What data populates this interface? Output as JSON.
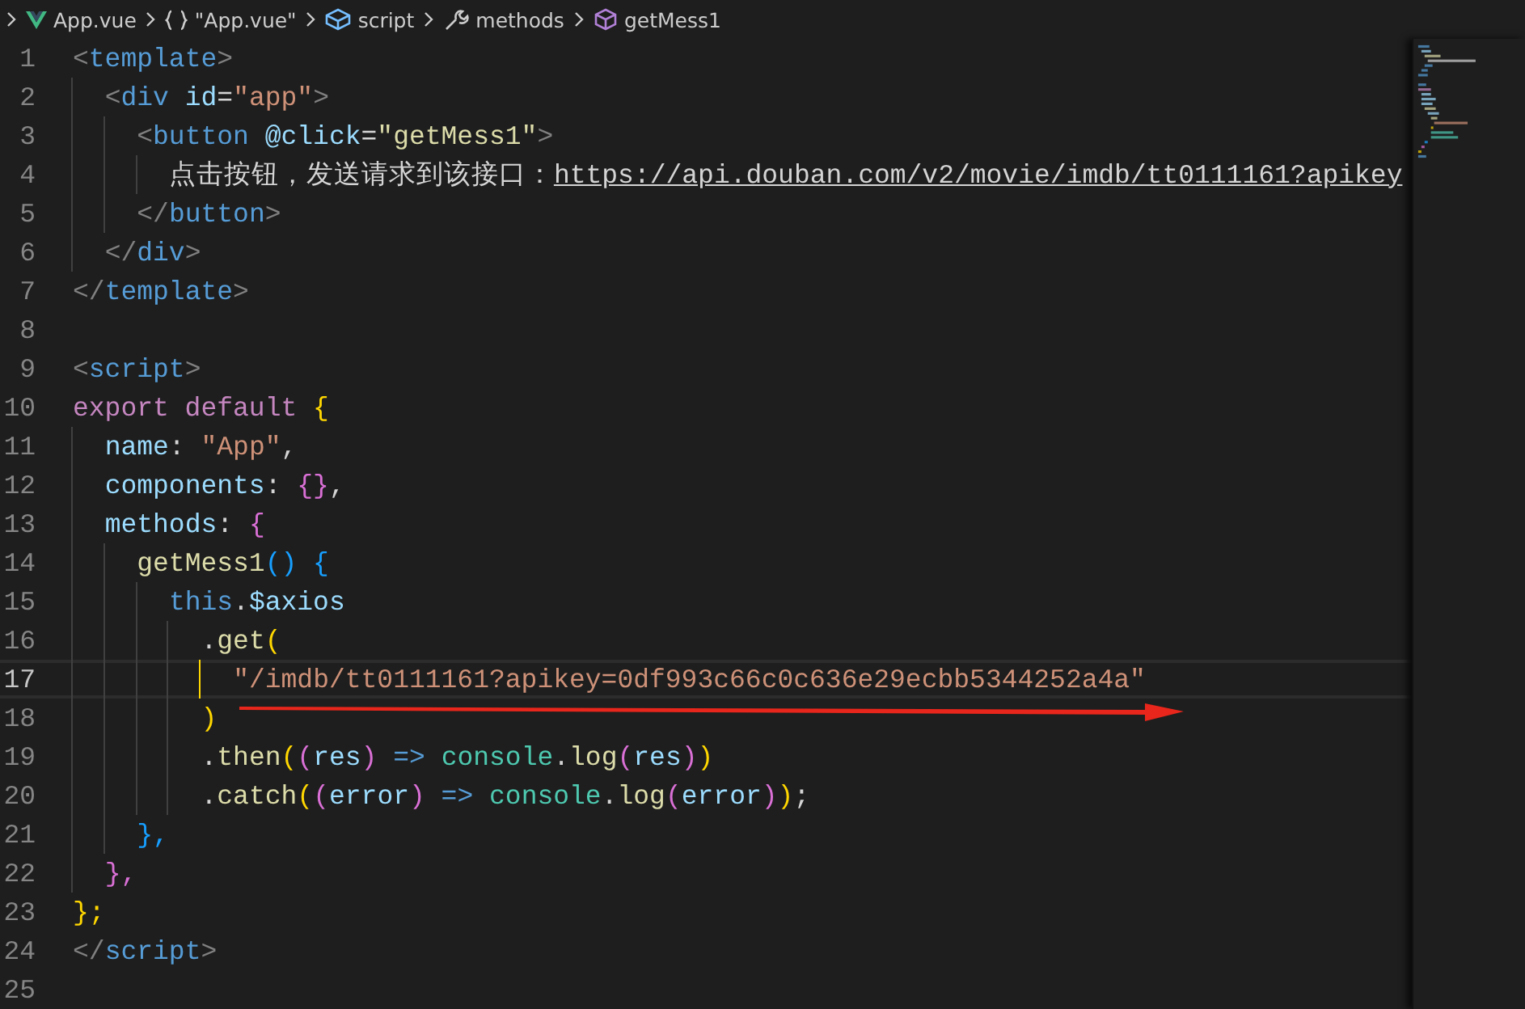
{
  "breadcrumb": [
    {
      "label": "App.vue",
      "kind": "vue"
    },
    {
      "label": "\"App.vue\"",
      "kind": "braces"
    },
    {
      "label": "script",
      "kind": "module"
    },
    {
      "label": "methods",
      "kind": "wrench"
    },
    {
      "label": "getMess1",
      "kind": "method"
    }
  ],
  "lines": [
    {
      "number": "1",
      "active": false,
      "tokens": [
        {
          "text": "<",
          "kind": "punct"
        },
        {
          "text": "template",
          "kind": "tag"
        },
        {
          "text": ">",
          "kind": "punct"
        }
      ]
    },
    {
      "number": "2",
      "active": false,
      "tokens": [
        {
          "text": "  <",
          "kind": "punct"
        },
        {
          "text": "div",
          "kind": "tag"
        },
        {
          "text": " id",
          "kind": "attr"
        },
        {
          "text": "=",
          "kind": "plain"
        },
        {
          "text": "\"app\"",
          "kind": "str"
        },
        {
          "text": ">",
          "kind": "punct"
        }
      ]
    },
    {
      "number": "3",
      "active": false,
      "tokens": [
        {
          "text": "    <",
          "kind": "punct"
        },
        {
          "text": "button",
          "kind": "tag"
        },
        {
          "text": " @click",
          "kind": "attr"
        },
        {
          "text": "=",
          "kind": "plain"
        },
        {
          "text": "\"getMess1\"",
          "kind": "fnstr"
        },
        {
          "text": ">",
          "kind": "punct"
        }
      ]
    },
    {
      "number": "4",
      "active": false,
      "tokens": [
        {
          "text": "      点击按钮，发送请求到该接口：",
          "kind": "plain"
        },
        {
          "text": "https://api.douban.com/v2/movie/imdb/tt0111161?apikey",
          "kind": "link"
        }
      ]
    },
    {
      "number": "5",
      "active": false,
      "tokens": [
        {
          "text": "    </",
          "kind": "punct"
        },
        {
          "text": "button",
          "kind": "tag"
        },
        {
          "text": ">",
          "kind": "punct"
        }
      ]
    },
    {
      "number": "6",
      "active": false,
      "tokens": [
        {
          "text": "  </",
          "kind": "punct"
        },
        {
          "text": "div",
          "kind": "tag"
        },
        {
          "text": ">",
          "kind": "punct"
        }
      ]
    },
    {
      "number": "7",
      "active": false,
      "tokens": [
        {
          "text": "</",
          "kind": "punct"
        },
        {
          "text": "template",
          "kind": "tag"
        },
        {
          "text": ">",
          "kind": "punct"
        }
      ]
    },
    {
      "number": "8",
      "active": false
    },
    {
      "number": "9",
      "active": false,
      "tokens": [
        {
          "text": "<",
          "kind": "punct"
        },
        {
          "text": "script",
          "kind": "tag"
        },
        {
          "text": ">",
          "kind": "punct"
        }
      ]
    },
    {
      "number": "10",
      "active": false,
      "tokens": [
        {
          "text": "export default ",
          "kind": "kw"
        },
        {
          "text": "{",
          "kind": "b1"
        }
      ]
    },
    {
      "number": "11",
      "active": false,
      "tokens": [
        {
          "text": "  name",
          "kind": "var"
        },
        {
          "text": ": ",
          "kind": "plain"
        },
        {
          "text": "\"App\"",
          "kind": "str"
        },
        {
          "text": ",",
          "kind": "plain"
        }
      ]
    },
    {
      "number": "12",
      "active": false,
      "tokens": [
        {
          "text": "  components",
          "kind": "var"
        },
        {
          "text": ": ",
          "kind": "plain"
        },
        {
          "text": "{}",
          "kind": "b2"
        },
        {
          "text": ",",
          "kind": "plain"
        }
      ]
    },
    {
      "number": "13",
      "active": false,
      "tokens": [
        {
          "text": "  methods",
          "kind": "var"
        },
        {
          "text": ": ",
          "kind": "plain"
        },
        {
          "text": "{",
          "kind": "b2"
        }
      ]
    },
    {
      "number": "14",
      "active": false,
      "tokens": [
        {
          "text": "    getMess1",
          "kind": "fn"
        },
        {
          "text": "() {",
          "kind": "b3"
        }
      ]
    },
    {
      "number": "15",
      "active": false,
      "tokens": [
        {
          "text": "      this",
          "kind": "tag"
        },
        {
          "text": ".",
          "kind": "plain"
        },
        {
          "text": "$axios",
          "kind": "var"
        }
      ]
    },
    {
      "number": "16",
      "active": false,
      "tokens": [
        {
          "text": "        .",
          "kind": "plain"
        },
        {
          "text": "get",
          "kind": "fn"
        },
        {
          "text": "(",
          "kind": "b1"
        }
      ]
    },
    {
      "number": "17",
      "active": true,
      "tokens": [
        {
          "text": "          \"/imdb/tt0111161?apikey=0df993c66c0c636e29ecbb5344252a4a\"",
          "kind": "str"
        }
      ]
    },
    {
      "number": "18",
      "active": false,
      "tokens": [
        {
          "text": "        )",
          "kind": "b1"
        }
      ]
    },
    {
      "number": "19",
      "active": false,
      "tokens": [
        {
          "text": "        .",
          "kind": "plain"
        },
        {
          "text": "then",
          "kind": "fn"
        },
        {
          "text": "(",
          "kind": "b1"
        },
        {
          "text": "(",
          "kind": "b2"
        },
        {
          "text": "res",
          "kind": "var"
        },
        {
          "text": ")",
          "kind": "b2"
        },
        {
          "text": " => ",
          "kind": "tag"
        },
        {
          "text": "console",
          "kind": "cls"
        },
        {
          "text": ".",
          "kind": "plain"
        },
        {
          "text": "log",
          "kind": "fn"
        },
        {
          "text": "(",
          "kind": "b2"
        },
        {
          "text": "res",
          "kind": "var"
        },
        {
          "text": ")",
          "kind": "b2"
        },
        {
          "text": ")",
          "kind": "b1"
        }
      ]
    },
    {
      "number": "20",
      "active": false,
      "tokens": [
        {
          "text": "        .",
          "kind": "plain"
        },
        {
          "text": "catch",
          "kind": "fn"
        },
        {
          "text": "(",
          "kind": "b1"
        },
        {
          "text": "(",
          "kind": "b2"
        },
        {
          "text": "error",
          "kind": "var"
        },
        {
          "text": ")",
          "kind": "b2"
        },
        {
          "text": " => ",
          "kind": "tag"
        },
        {
          "text": "console",
          "kind": "cls"
        },
        {
          "text": ".",
          "kind": "plain"
        },
        {
          "text": "log",
          "kind": "fn"
        },
        {
          "text": "(",
          "kind": "b2"
        },
        {
          "text": "error",
          "kind": "var"
        },
        {
          "text": ")",
          "kind": "b2"
        },
        {
          "text": ")",
          "kind": "b1"
        },
        {
          "text": ";",
          "kind": "plain"
        }
      ]
    },
    {
      "number": "21",
      "active": false,
      "tokens": [
        {
          "text": "    },",
          "kind": "b3"
        }
      ]
    },
    {
      "number": "22",
      "active": false,
      "tokens": [
        {
          "text": "  },",
          "kind": "b2"
        }
      ]
    },
    {
      "number": "23",
      "active": false,
      "tokens": [
        {
          "text": "};",
          "kind": "b1"
        }
      ]
    },
    {
      "number": "24",
      "active": false,
      "tokens": [
        {
          "text": "</",
          "kind": "punct"
        },
        {
          "text": "script",
          "kind": "tag"
        },
        {
          "text": ">",
          "kind": "punct"
        }
      ]
    },
    {
      "number": "25",
      "active": false
    }
  ]
}
